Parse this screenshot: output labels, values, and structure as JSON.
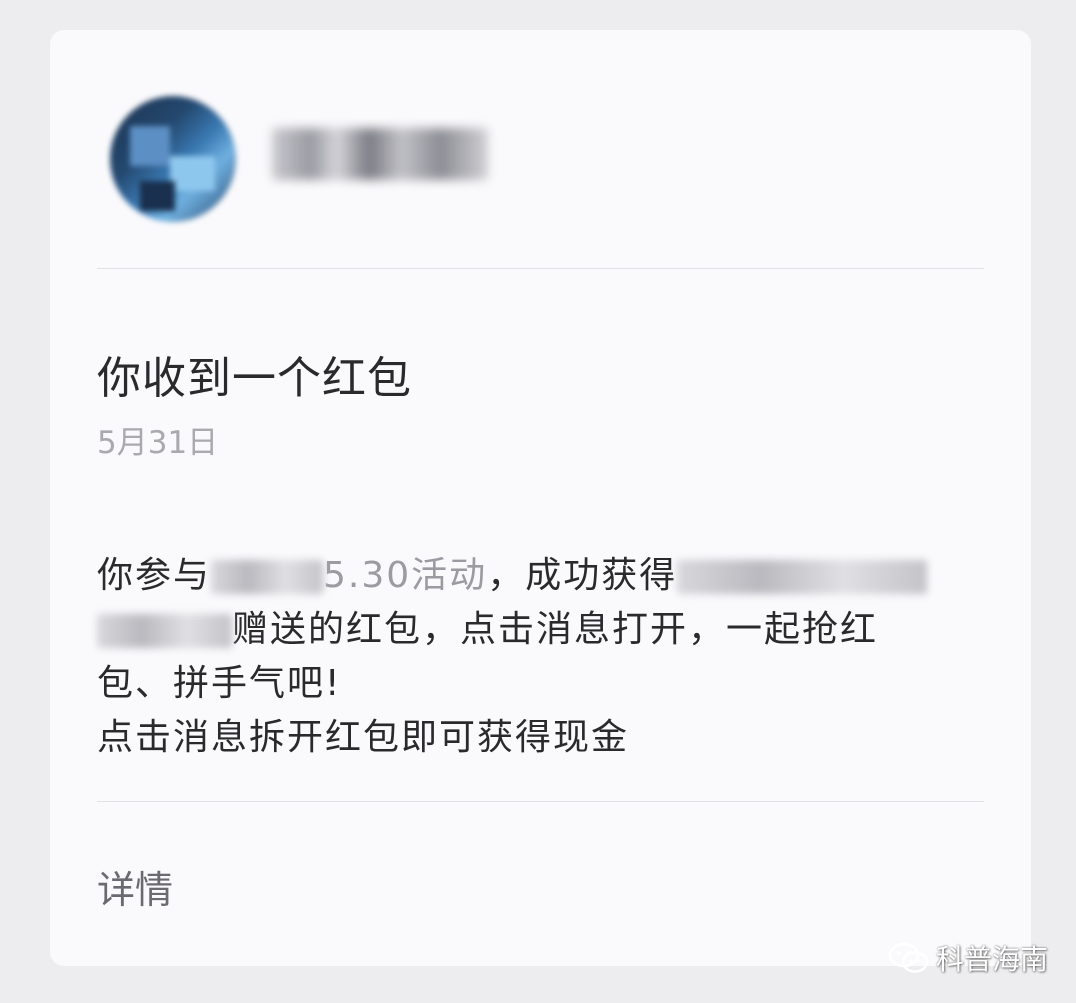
{
  "notification": {
    "title": "你收到一个红包",
    "date": "5月31日",
    "message": {
      "line1_start": "你参与",
      "line1_activity": "5.30活动",
      "line1_mid": "，成功获得",
      "line2_end": "赠送的红包，点击消息打开，一起抢红",
      "line3": "包、拼手气吧!",
      "line4": "点击消息拆开红包即可获得现金"
    },
    "details_label": "详情"
  },
  "watermark": {
    "text": "科普海南",
    "icon": "wechat-icon"
  }
}
